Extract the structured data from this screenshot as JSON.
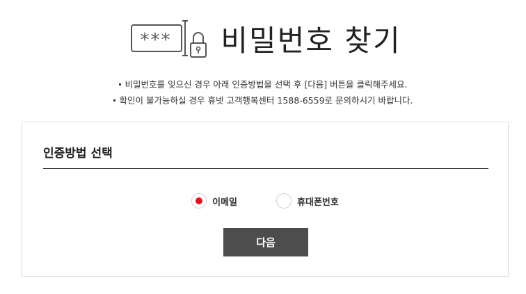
{
  "header": {
    "title": "비밀번호 찾기",
    "icon": "password-lock-icon"
  },
  "notes": [
    "비밀번호를 잊으신 경우 아래 인증방법을 선택 후 [다음] 버튼을 클릭해주세요.",
    "확인이 불가능하실 경우 휴넷 고객행복센터 1588-6559로 문의하시기 바랍니다."
  ],
  "auth": {
    "section_title": "인증방법 선택",
    "options": [
      {
        "label": "이메일",
        "selected": true
      },
      {
        "label": "휴대폰번호",
        "selected": false
      }
    ],
    "next_label": "다음"
  },
  "colors": {
    "accent": "#e0131f",
    "button_bg": "#4d4d4d",
    "divider": "#333333",
    "border": "#dcdcdc"
  }
}
